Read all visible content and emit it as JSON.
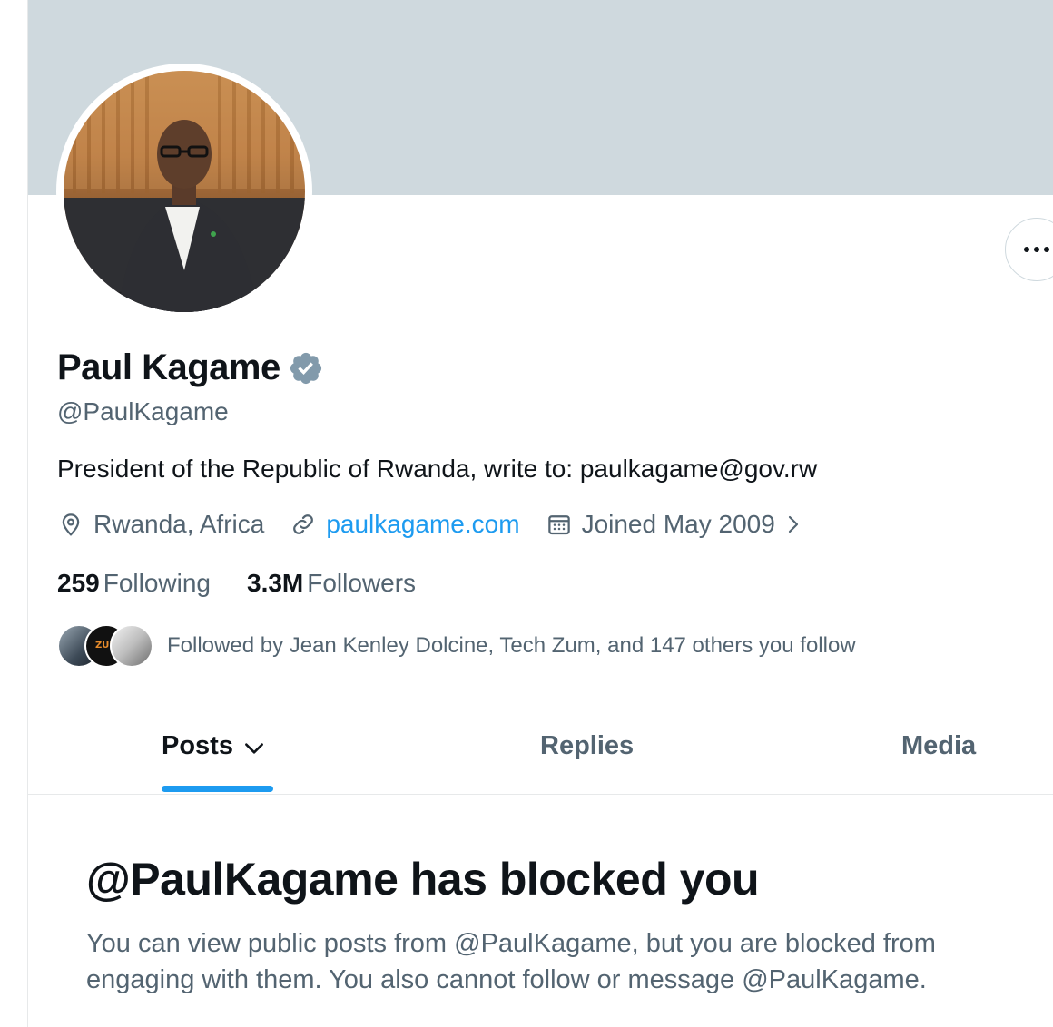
{
  "profile": {
    "display_name": "Paul Kagame",
    "handle": "@PaulKagame",
    "bio": "President of the Republic of Rwanda, write to: paulkagame@gov.rw",
    "location": "Rwanda, Africa",
    "website": "paulkagame.com",
    "joined": "Joined May 2009",
    "following_count": "259",
    "following_label": "Following",
    "followers_count": "3.3M",
    "followers_label": "Followers",
    "followed_by_text": "Followed by Jean Kenley Dolcine, Tech Zum, and 147 others you follow",
    "mini_avatar_label": "ZUM"
  },
  "icons": {
    "verified": "verified-badge-icon",
    "location": "location-pin-icon",
    "link": "link-icon",
    "calendar": "calendar-icon",
    "more": "more-options-icon",
    "chevron": "chevron-down-icon"
  },
  "tabs": [
    {
      "label": "Posts",
      "active": true
    },
    {
      "label": "Replies",
      "active": false
    },
    {
      "label": "Media",
      "active": false
    }
  ],
  "blocked": {
    "title": "@PaulKagame has blocked you",
    "description": "You can view public posts from @PaulKagame, but you are blocked from engaging with them. You also cannot follow or message @PaulKagame."
  },
  "colors": {
    "accent": "#1d9bf0",
    "banner": "#cfd9de",
    "secondary_text": "#536471",
    "primary_text": "#0f1419",
    "verified_badge": "#829aab"
  }
}
